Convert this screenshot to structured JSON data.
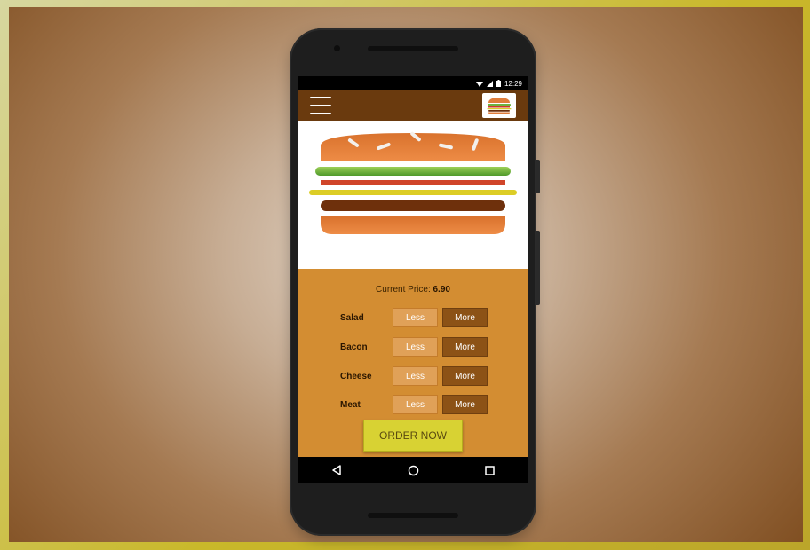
{
  "colors": {
    "outer_frame": "#c9b82a",
    "app_bar": "#6a3a0e",
    "controls_bg": "#d38d32",
    "less_button": "#e0a158",
    "more_button": "#8c5216",
    "order_button": "#d8d233"
  },
  "status_bar": {
    "time": "12:29",
    "icons": [
      "wifi-icon",
      "signal-icon",
      "battery-icon"
    ]
  },
  "app_bar": {
    "menu_icon": "hamburger-icon",
    "logo": "burger-logo-icon"
  },
  "hero": {
    "image": "burger-illustration"
  },
  "price": {
    "label": "Current Price: ",
    "value": "6.90"
  },
  "ingredients": [
    {
      "name": "Salad",
      "less_label": "Less",
      "more_label": "More"
    },
    {
      "name": "Bacon",
      "less_label": "Less",
      "more_label": "More"
    },
    {
      "name": "Cheese",
      "less_label": "Less",
      "more_label": "More"
    },
    {
      "name": "Meat",
      "less_label": "Less",
      "more_label": "More"
    }
  ],
  "order_button": {
    "label": "ORDER NOW"
  },
  "nav_bar": {
    "icons": [
      "back-icon",
      "home-icon",
      "recents-icon"
    ]
  }
}
